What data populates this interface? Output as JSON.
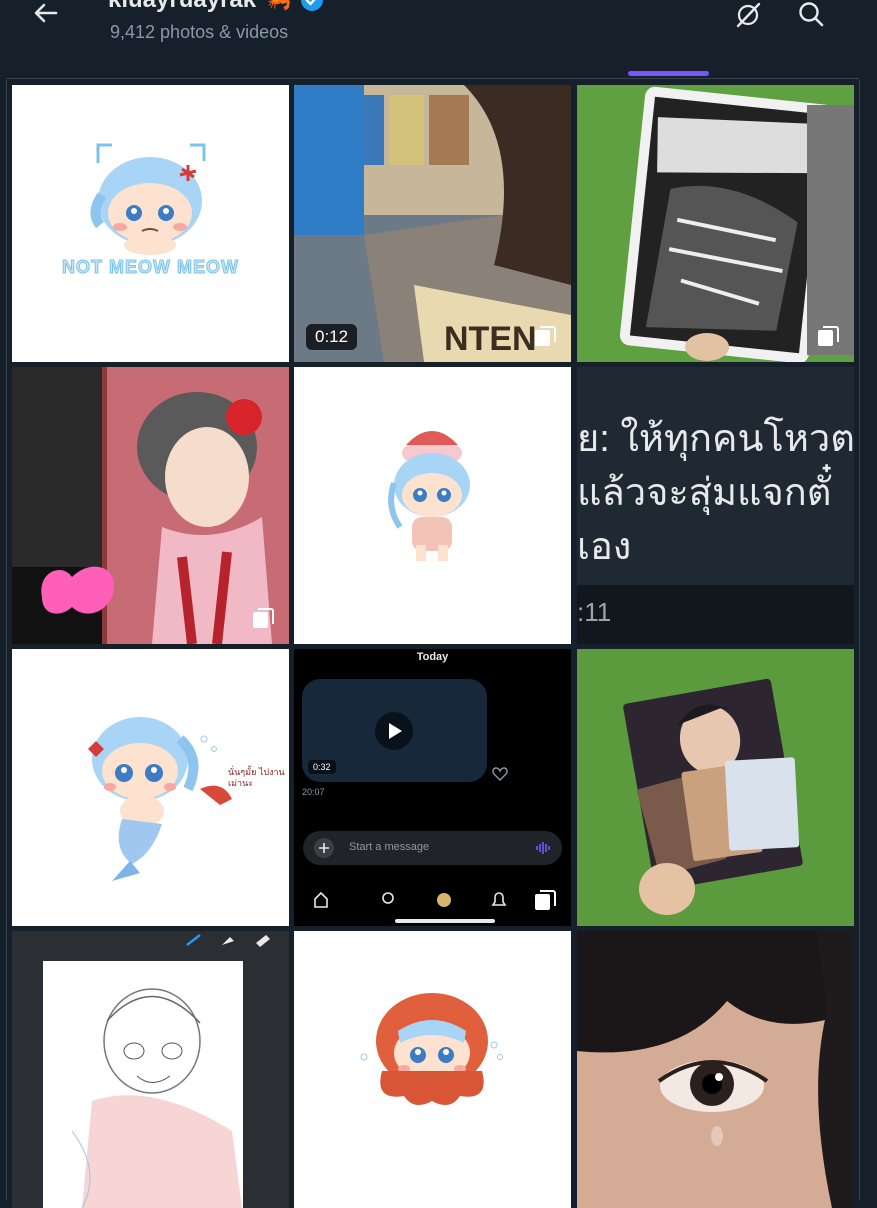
{
  "header": {
    "title": "kluayruayrak",
    "title_emoji": "🦐",
    "verified_icon": "verified-badge-icon",
    "media_count": "9,412 photos & videos",
    "accent_color": "#7856ff",
    "icons": [
      "back-arrow-icon",
      "grok-icon",
      "search-icon"
    ]
  },
  "grid": {
    "tiles": [
      {
        "kind": "chibi-sticker",
        "caption": "NOT MEOW MEOW"
      },
      {
        "kind": "video",
        "duration": "0:12",
        "multi": true
      },
      {
        "kind": "photo-manga-cards",
        "multi": true
      },
      {
        "kind": "photo-cosplay-poster",
        "multi": true
      },
      {
        "kind": "chibi-strawberry"
      },
      {
        "kind": "screenshot-text",
        "line1": "ย: ให้ทุกคนโหวต",
        "line2": " แล้วจะสุ่มแจกตั๋",
        "line3": "เอง",
        "timestamp": ":11"
      },
      {
        "kind": "chibi-mermaid",
        "note": "นั่นๆมั้ย ไปงานเม่านะ"
      },
      {
        "kind": "dm-screenshot",
        "day_label": "Today",
        "video_duration": "0:32",
        "time": "20:07",
        "input_placeholder": "Start a message",
        "multi": true
      },
      {
        "kind": "photo-book-cards"
      },
      {
        "kind": "sketch-drawing"
      },
      {
        "kind": "chibi-octopus"
      },
      {
        "kind": "photo-eye-closeup"
      }
    ]
  }
}
